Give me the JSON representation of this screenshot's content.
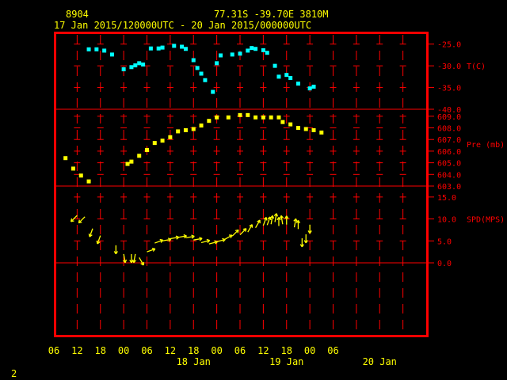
{
  "header": {
    "station_id": "8904",
    "location": "77.31S   -39.70E   3810M",
    "time_range": "17 Jan 2015/120000UTC - 20 Jan 2015/000000UTC"
  },
  "footer": {
    "page_number": "2"
  },
  "colors": {
    "background": "#000000",
    "frame": "#ff0000",
    "grid": "#ff0000",
    "axis_text": "#ffff00",
    "label_text": "#ff0000",
    "temperature": "#00ffff",
    "pressure": "#ffff00",
    "wind": "#ffff00"
  },
  "x_axis": {
    "hour_ticks": [
      "06",
      "12",
      "18",
      "00",
      "06",
      "12",
      "18",
      "00",
      "06",
      "12",
      "18",
      "00",
      "06"
    ],
    "day_labels": [
      {
        "text": "18 Jan",
        "hours": 42
      },
      {
        "text": "19 Jan",
        "hours": 66
      },
      {
        "text": "20 Jan",
        "hours": 90
      }
    ]
  },
  "chart_data": [
    {
      "type": "scatter",
      "panel": "temperature",
      "ylabel": "T(C)",
      "ylim": [
        -40.0,
        -22.5
      ],
      "yticks": [
        "-25.0",
        "-30.0",
        "-35.0",
        "-40.0"
      ],
      "ytick_values": [
        -25.0,
        -30.0,
        -35.0,
        -40.0
      ],
      "x_units": "hours since 17 Jan 2015 00 UTC",
      "x": [
        15,
        17,
        19,
        21,
        24,
        26,
        27,
        28,
        29,
        31,
        33,
        34,
        37,
        39,
        40,
        42,
        43,
        44,
        45,
        47,
        48,
        49,
        52,
        54,
        56,
        57,
        58,
        60,
        61,
        63,
        64,
        66,
        67,
        69,
        72,
        73
      ],
      "y": [
        -26.2,
        -26.2,
        -26.5,
        -27.4,
        -30.8,
        -30.3,
        -29.9,
        -29.4,
        -29.7,
        -26.0,
        -26.0,
        -25.8,
        -25.4,
        -25.6,
        -26.1,
        -28.7,
        -30.5,
        -31.8,
        -33.3,
        -36.0,
        -29.4,
        -27.6,
        -27.4,
        -27.2,
        -26.5,
        -25.9,
        -26.1,
        -26.4,
        -27.0,
        -30.0,
        -32.5,
        -32.1,
        -32.8,
        -34.1,
        -35.2,
        -34.8
      ]
    },
    {
      "type": "scatter",
      "panel": "pressure",
      "ylabel": "Pre (mb)",
      "ylim": [
        603.0,
        609.6
      ],
      "yticks": [
        "609.0",
        "608.0",
        "607.0",
        "606.0",
        "605.0",
        "604.0",
        "603.0"
      ],
      "ytick_values": [
        609.0,
        608.0,
        607.0,
        606.0,
        605.0,
        604.0,
        603.0
      ],
      "x_units": "hours since 17 Jan 2015 00 UTC",
      "x": [
        9,
        11,
        13,
        15,
        25,
        26,
        28,
        30,
        32,
        34,
        36,
        38,
        40,
        42,
        44,
        46,
        48,
        51,
        54,
        56,
        58,
        60,
        62,
        64,
        65,
        67,
        69,
        71,
        73,
        75
      ],
      "y": [
        605.4,
        604.5,
        603.9,
        603.4,
        604.9,
        605.1,
        605.6,
        606.1,
        606.7,
        606.9,
        607.2,
        607.7,
        607.8,
        607.9,
        608.2,
        608.6,
        608.9,
        608.9,
        609.1,
        609.1,
        608.9,
        608.9,
        608.9,
        608.9,
        608.5,
        608.3,
        608.0,
        607.9,
        607.8,
        607.6
      ]
    },
    {
      "type": "wind",
      "panel": "wind_speed",
      "ylabel": "SPD(MPS)",
      "ylim": [
        0.0,
        17.5
      ],
      "yticks": [
        "15.0",
        "10.0",
        "5.0",
        "0.0"
      ],
      "ytick_values": [
        15.0,
        10.0,
        5.0,
        0.0
      ],
      "x_units": "hours since 17 Jan 2015 00 UTC",
      "x": [
        12,
        14,
        16,
        18,
        22,
        24,
        26,
        27,
        28,
        30,
        32,
        34,
        36,
        38,
        40,
        42,
        44,
        46,
        48,
        50,
        52,
        54,
        56,
        58,
        60,
        61,
        62,
        63,
        64,
        65,
        66,
        68,
        69,
        70,
        71,
        72
      ],
      "speed": [
        10.8,
        10.5,
        7.8,
        6.2,
        4.0,
        2.0,
        2.0,
        2.0,
        1.2,
        2.5,
        4.5,
        5.0,
        5.5,
        5.8,
        5.7,
        5.2,
        4.6,
        4.3,
        4.8,
        5.3,
        6.1,
        6.4,
        7.0,
        8.0,
        8.5,
        8.6,
        8.8,
        9.3,
        8.4,
        8.8,
        8.7,
        8.1,
        7.7,
        5.6,
        6.5,
        8.7
      ],
      "dir_deg_from_east": [
        225,
        225,
        250,
        250,
        270,
        280,
        270,
        260,
        300,
        20,
        20,
        10,
        10,
        10,
        10,
        10,
        15,
        15,
        15,
        30,
        45,
        45,
        60,
        60,
        70,
        70,
        80,
        80,
        90,
        100,
        90,
        80,
        90,
        270,
        270,
        270
      ]
    }
  ]
}
